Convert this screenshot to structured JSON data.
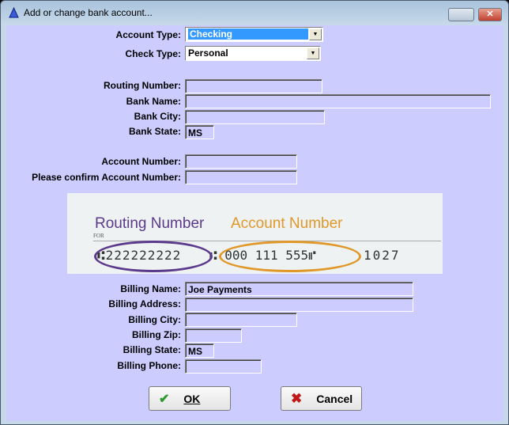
{
  "window": {
    "title": "Add or change bank account..."
  },
  "fields": {
    "account_type": {
      "label": "Account Type:",
      "value": "Checking"
    },
    "check_type": {
      "label": "Check Type:",
      "value": "Personal"
    },
    "routing_number": {
      "label": "Routing Number:",
      "value": ""
    },
    "bank_name": {
      "label": "Bank Name:",
      "value": ""
    },
    "bank_city": {
      "label": "Bank City:",
      "value": ""
    },
    "bank_state": {
      "label": "Bank State:",
      "value": "MS"
    },
    "account_number": {
      "label": "Account Number:",
      "value": ""
    },
    "confirm_account": {
      "label": "Please confirm Account Number:",
      "value": ""
    },
    "billing_name": {
      "label": "Billing Name:",
      "value": "Joe Payments"
    },
    "billing_address": {
      "label": "Billing Address:",
      "value": ""
    },
    "billing_city": {
      "label": "Billing City:",
      "value": ""
    },
    "billing_zip": {
      "label": "Billing Zip:",
      "value": ""
    },
    "billing_state": {
      "label": "Billing State:",
      "value": "MS"
    },
    "billing_phone": {
      "label": "Billing Phone:",
      "value": ""
    }
  },
  "check_image": {
    "routing_label": "Routing Number",
    "account_label": "Account Number",
    "for": "FOR",
    "routing_digits": "⑆222222222",
    "account_digits": "⑆ 000 111 555⑈",
    "check_no": "1027",
    "routing_color": "#5b3a8c",
    "account_color": "#e0982a"
  },
  "buttons": {
    "ok": "OK",
    "cancel": "Cancel"
  }
}
